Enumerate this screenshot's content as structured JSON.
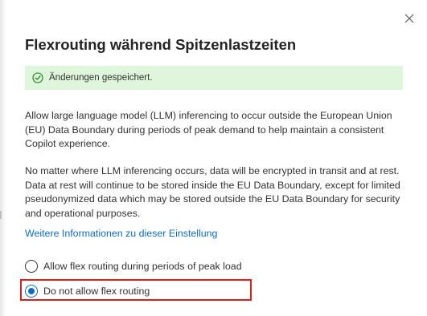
{
  "panel": {
    "title": "Flexrouting während Spitzenlastzeiten",
    "close_icon": "close-icon"
  },
  "message_bar": {
    "icon": "checkmark-circle-icon",
    "text": "Änderungen gespeichert.",
    "color": "#dff6dd"
  },
  "description": {
    "paragraph1": "Allow large language model (LLM) inferencing to occur outside the European Union (EU) Data Boundary during periods of peak demand to help maintain a consistent Copilot experience.",
    "paragraph2": "No matter where LLM inferencing occurs, data will be encrypted in transit and at rest. Data at rest will continue to be stored inside the EU Data Boundary, except for limited pseudonymized data which may be stored outside the EU Data Boundary for security and operational purposes."
  },
  "learn_more_link": "Weitere Informationen zu dieser Einstellung",
  "options": [
    {
      "label": "Allow flex routing during periods of peak load",
      "selected": false
    },
    {
      "label": "Do not allow flex routing",
      "selected": true
    }
  ],
  "colors": {
    "accent": "#0f6cbd",
    "highlight_border": "#d9201f",
    "success_bg": "#dff6dd",
    "success_icon": "#107c10"
  }
}
